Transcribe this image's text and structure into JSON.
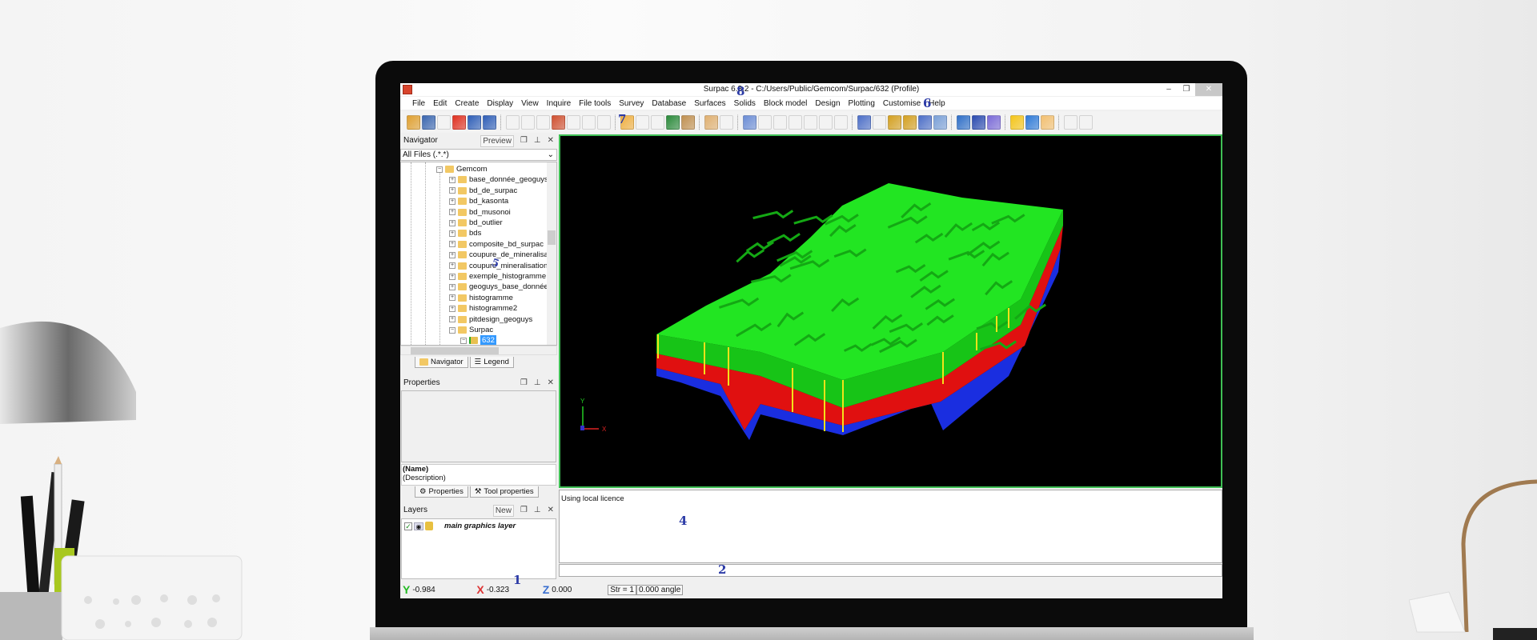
{
  "window": {
    "title": "Surpac 6.3.2 - C:/Users/Public/Gemcom/Surpac/632 (Profile)",
    "minimize": "–",
    "restore": "❐",
    "close": "✕"
  },
  "menu": [
    "File",
    "Edit",
    "Create",
    "Display",
    "View",
    "Inquire",
    "File tools",
    "Survey",
    "Database",
    "Surfaces",
    "Solids",
    "Block model",
    "Design",
    "Plotting",
    "Customise",
    "Help"
  ],
  "toolbar": [
    {
      "name": "open-icon",
      "color": "#e0a030"
    },
    {
      "name": "save-icon",
      "color": "#3a66b0"
    },
    {
      "name": "print-icon",
      "color": "#555"
    },
    {
      "name": "explode-icon",
      "color": "#e03020"
    },
    {
      "name": "undo-icon",
      "color": "#2f5fb8"
    },
    {
      "name": "redo-icon",
      "color": "#2f5fb8"
    },
    {
      "name": "sep"
    },
    {
      "name": "zoom-in-icon",
      "color": "#9ab"
    },
    {
      "name": "zoom-out-icon",
      "color": "#9ab"
    },
    {
      "name": "zoom-extents-icon",
      "color": "#8ab"
    },
    {
      "name": "rotate-icon",
      "color": "#d05030"
    },
    {
      "name": "view-plan-icon",
      "color": "#5a5"
    },
    {
      "name": "view-section-icon",
      "color": "#5a5"
    },
    {
      "name": "view-long-icon",
      "color": "#5a5"
    },
    {
      "name": "sep"
    },
    {
      "name": "orbit-icon",
      "color": "#f0b040"
    },
    {
      "name": "select-arrow-icon",
      "color": "#fff"
    },
    {
      "name": "select-box-icon",
      "color": "#ddd"
    },
    {
      "name": "move-icon",
      "color": "#2a8a3a"
    },
    {
      "name": "layer-icon",
      "color": "#c09050"
    },
    {
      "name": "sep"
    },
    {
      "name": "point-icon",
      "color": "#e0b070"
    },
    {
      "name": "delete-point-icon",
      "color": "#444"
    },
    {
      "name": "sep"
    },
    {
      "name": "digitize-icon",
      "color": "#6b8dd6"
    },
    {
      "name": "line-icon",
      "color": "#a33"
    },
    {
      "name": "line2-icon",
      "color": "#a33"
    },
    {
      "name": "line3-icon",
      "color": "#5a5"
    },
    {
      "name": "line4-icon",
      "color": "#5a5"
    },
    {
      "name": "line5-icon",
      "color": "#a55"
    },
    {
      "name": "new-string-icon",
      "color": "#3a3"
    },
    {
      "name": "sep"
    },
    {
      "name": "section-icon",
      "color": "#4d6fc8"
    },
    {
      "name": "section-delete-icon",
      "color": "#c33"
    },
    {
      "name": "section-prev-icon",
      "color": "#d4a020"
    },
    {
      "name": "section-next-icon",
      "color": "#d4a020"
    },
    {
      "name": "section-list-icon",
      "color": "#4d6fc8"
    },
    {
      "name": "section-find-icon",
      "color": "#7aa0d8"
    },
    {
      "name": "sep"
    },
    {
      "name": "report-icon",
      "color": "#2f6fc8"
    },
    {
      "name": "display-icon",
      "color": "#2a4ab0"
    },
    {
      "name": "pencil-icon",
      "color": "#7a6ad8"
    },
    {
      "name": "sep"
    },
    {
      "name": "light-icon",
      "color": "#f5c518"
    },
    {
      "name": "shade-icon",
      "color": "#2e7ad8"
    },
    {
      "name": "wireframe-icon",
      "color": "#f3c070"
    },
    {
      "name": "sep"
    },
    {
      "name": "record-icon",
      "color": "#d33"
    },
    {
      "name": "play-icon",
      "color": "#3b3"
    }
  ],
  "navigator": {
    "title": "Navigator",
    "preview": "Preview",
    "filter": "All Files (.*.*)",
    "root": "Gemcom",
    "folders": [
      "base_donnée_geoguys",
      "bd_de_surpac",
      "bd_kasonta",
      "bd_musonoi",
      "bd_outlier",
      "bds",
      "composite_bd_surpac",
      "coupure_de_mineralisatic",
      "coupure_mineralisation",
      "exemple_histogramme",
      "geoguys_base_donnée",
      "histogramme",
      "histogramme2",
      "pitdesign_geoguys",
      "Surpac"
    ],
    "selected": "632",
    "tabs": [
      "Navigator",
      "Legend"
    ]
  },
  "properties": {
    "title": "Properties",
    "name": "(Name)",
    "description": "(Description)",
    "tabs": [
      "Properties",
      "Tool properties"
    ]
  },
  "layers": {
    "title": "Layers",
    "new": "New",
    "items": [
      {
        "label": "main graphics layer",
        "checked": true
      }
    ]
  },
  "viewport": {
    "axis_y": "Y",
    "axis_x": "X",
    "axis_z": "Z",
    "colors": {
      "top": "#22e522",
      "mid": "#e01010",
      "bottom": "#1a2ee0",
      "drill": "#f3e21a",
      "border": "#3fbf55"
    }
  },
  "messages": {
    "text": "Using local licence"
  },
  "status": {
    "y": "-0.984",
    "x": "-0.323",
    "z": "0.000",
    "str": "Str = 1",
    "angle": "0.000 angle"
  },
  "annotations": {
    "a1": "1",
    "a2": "2",
    "a4": "4",
    "a5": "5",
    "a6": "6",
    "a7": "7",
    "a8": "8"
  }
}
